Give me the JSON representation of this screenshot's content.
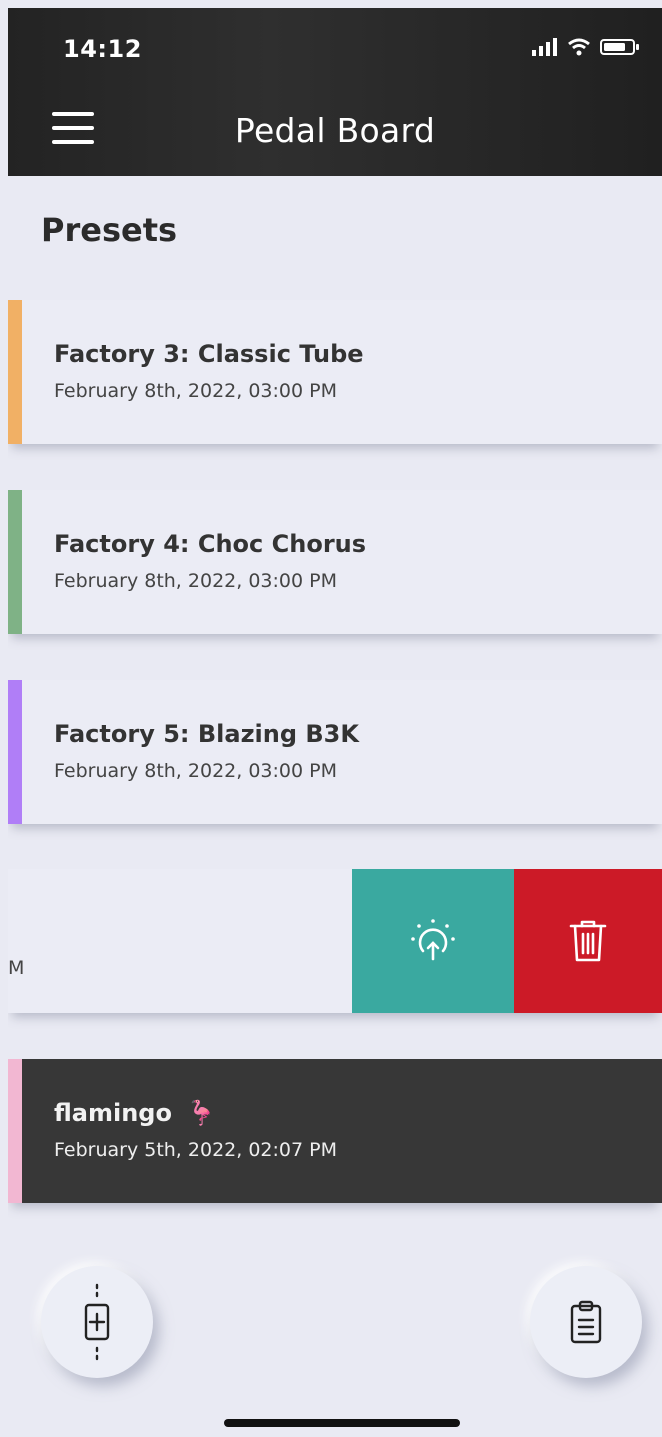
{
  "status_bar": {
    "time": "14:12"
  },
  "header": {
    "title": "Pedal Board"
  },
  "section": {
    "title": "Presets"
  },
  "presets": [
    {
      "name": "Factory 3: Classic Tube",
      "date": "February 8th, 2022, 03:00 PM",
      "color": "#f1b065"
    },
    {
      "name": "Factory 4: Choc Chorus",
      "date": "February 8th, 2022, 03:00 PM",
      "color": "#7fb286"
    },
    {
      "name": "Factory 5: Blazing B3K",
      "date": "February 8th, 2022, 03:00 PM",
      "color": "#b07ef7"
    }
  ],
  "swiped_row": {
    "visible_text": "M"
  },
  "selected_preset": {
    "name": "flamingo",
    "emoji": "🦩",
    "date": "February 5th, 2022, 02:07 PM",
    "color": "#f2b7d2"
  },
  "colors": {
    "load_action": "#3aa9a0",
    "delete_action": "#cc1a27",
    "header_bg": "#262626"
  },
  "icons": {
    "load": "load-preset-icon",
    "delete": "trash-icon",
    "add": "add-pedal-icon",
    "clipboard": "clipboard-icon",
    "menu": "hamburger-menu-icon"
  }
}
